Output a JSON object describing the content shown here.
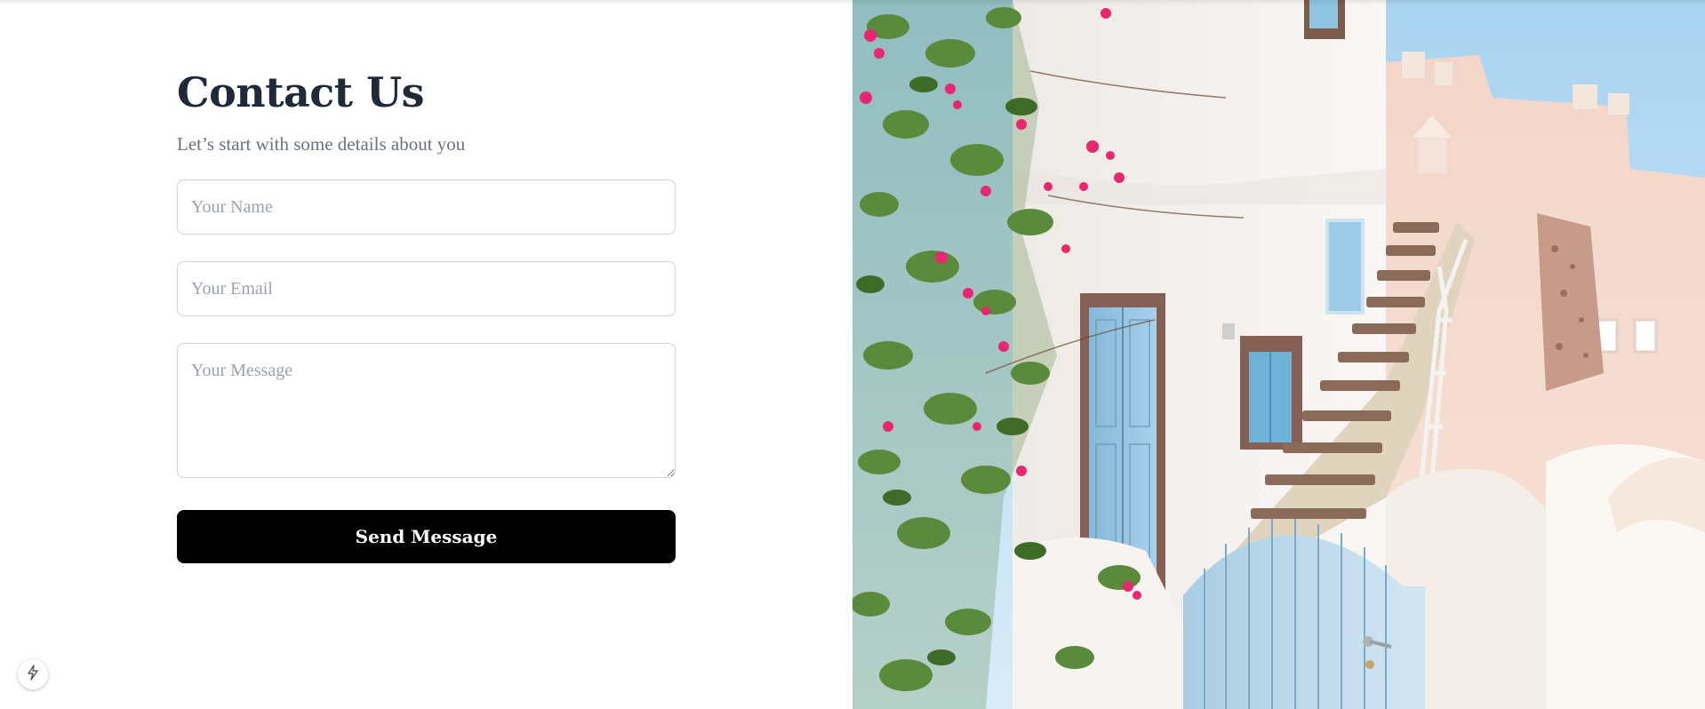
{
  "contact": {
    "title": "Contact Us",
    "subtitle": "Let’s start with some details about you",
    "name_placeholder": "Your Name",
    "name_value": "",
    "email_placeholder": "Your Email",
    "email_value": "",
    "message_placeholder": "Your Message",
    "message_value": "",
    "send_label": "Send Message"
  },
  "image": {
    "subject": "Whitewashed buildings with blue doors, stone staircase and pink bougainvillea"
  },
  "icons": {
    "badge_icon": "lightning-bolt-icon"
  },
  "colors": {
    "button_bg": "#000000",
    "button_text": "#ffffff",
    "title": "#1f2937",
    "subtitle": "#6b7280",
    "field_border": "#d1d5db"
  }
}
